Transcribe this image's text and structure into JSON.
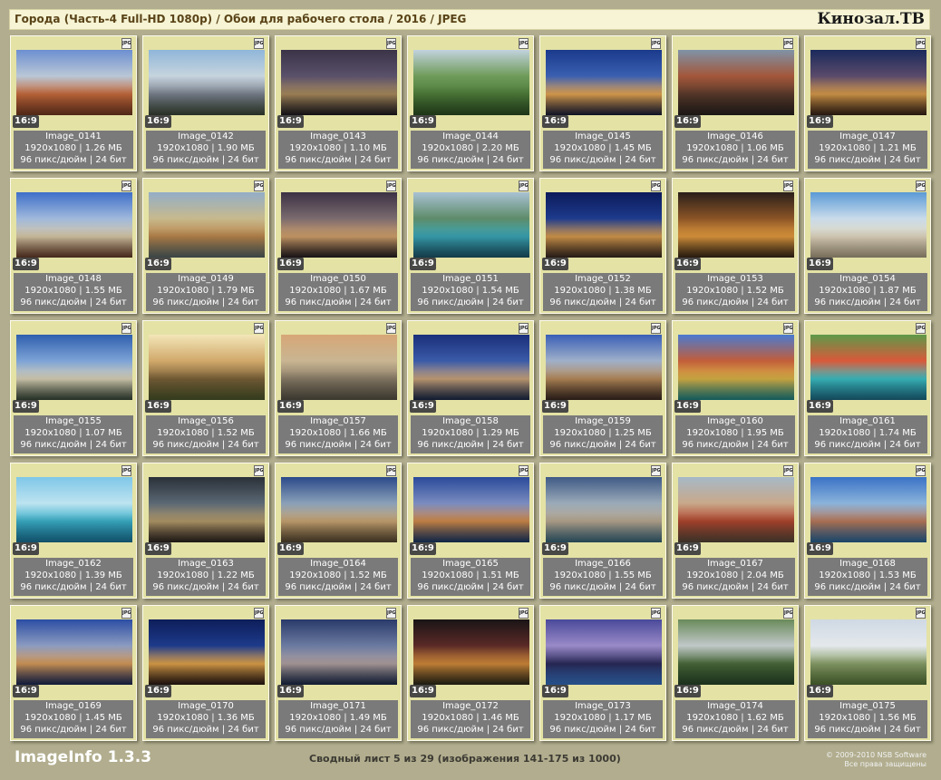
{
  "header": {
    "title": "Города (Часть-4 Full-HD 1080p) / Обои для рабочего стола / 2016 / JPEG",
    "brand": "Кинозал.TB"
  },
  "card_common": {
    "format_icon": "jpg-file-icon",
    "format_label": "JPG",
    "ratio": "16:9",
    "resolution_info": "96 пикс/дюйм | 24 бит"
  },
  "images": [
    {
      "name": "Image_0141",
      "dims": "1920x1080 | 1.26 МБ",
      "colors": [
        "#6d8fd1",
        "#b9c7d6",
        "#c76b3c",
        "#7a3b22"
      ]
    },
    {
      "name": "Image_0142",
      "dims": "1920x1080 | 1.90 МБ",
      "colors": [
        "#8fb6d9",
        "#c6d4de",
        "#7b8390",
        "#3e4a3a"
      ]
    },
    {
      "name": "Image_0143",
      "dims": "1920x1080 | 1.10 МБ",
      "colors": [
        "#3b3447",
        "#59506a",
        "#a88a5c",
        "#1f1b22"
      ]
    },
    {
      "name": "Image_0144",
      "dims": "1920x1080 | 2.20 МБ",
      "colors": [
        "#c2d3de",
        "#6f9b5a",
        "#4e7d3a",
        "#2e5224"
      ]
    },
    {
      "name": "Image_0145",
      "dims": "1920x1080 | 1.45 МБ",
      "colors": [
        "#1b3a8c",
        "#3a5fb0",
        "#e4a451",
        "#1a1f3a"
      ]
    },
    {
      "name": "Image_0146",
      "dims": "1920x1080 | 1.06 МБ",
      "colors": [
        "#7f93a8",
        "#a3573a",
        "#5b3b2c",
        "#2a2320"
      ]
    },
    {
      "name": "Image_0147",
      "dims": "1920x1080 | 1.21 МБ",
      "colors": [
        "#1a2a5c",
        "#5a4a6a",
        "#d79a4a",
        "#3a2418"
      ]
    },
    {
      "name": "Image_0148",
      "dims": "1920x1080 | 1.55 МБ",
      "colors": [
        "#3f6fc9",
        "#9fb8dc",
        "#d8c8a6",
        "#6a3e2a"
      ]
    },
    {
      "name": "Image_0149",
      "dims": "1920x1080 | 1.79 МБ",
      "colors": [
        "#93aec8",
        "#c7b98d",
        "#b9854b",
        "#5a6a6a"
      ]
    },
    {
      "name": "Image_0150",
      "dims": "1920x1080 | 1.67 МБ",
      "colors": [
        "#3c3244",
        "#7a6a6e",
        "#d1a06a",
        "#251d22"
      ]
    },
    {
      "name": "Image_0151",
      "dims": "1920x1080 | 1.54 МБ",
      "colors": [
        "#a9c2d4",
        "#5e8c6a",
        "#3aa6b7",
        "#1f5a6e"
      ]
    },
    {
      "name": "Image_0152",
      "dims": "1920x1080 | 1.38 МБ",
      "colors": [
        "#0c1a5a",
        "#1d3a8c",
        "#d69a4c",
        "#3a2a22"
      ]
    },
    {
      "name": "Image_0153",
      "dims": "1920x1080 | 1.52 МБ",
      "colors": [
        "#2a1f1a",
        "#8a5426",
        "#e29a3e",
        "#3a2818"
      ]
    },
    {
      "name": "Image_0154",
      "dims": "1920x1080 | 1.87 МБ",
      "colors": [
        "#5a9ad6",
        "#c9dbea",
        "#e2d8c0",
        "#b7a88a"
      ]
    },
    {
      "name": "Image_0155",
      "dims": "1920x1080 | 1.07 МБ",
      "colors": [
        "#2f5fae",
        "#7da3d6",
        "#d9d1b6",
        "#3a4a3a"
      ]
    },
    {
      "name": "Image_0156",
      "dims": "1920x1080 | 1.52 МБ",
      "colors": [
        "#f3e6b8",
        "#d1a96b",
        "#7a6038",
        "#4e5a2c"
      ]
    },
    {
      "name": "Image_0157",
      "dims": "1920x1080 | 1.66 МБ",
      "colors": [
        "#d7a777",
        "#c9b592",
        "#8a7d68",
        "#5a5548"
      ]
    },
    {
      "name": "Image_0158",
      "dims": "1920x1080 | 1.29 МБ",
      "colors": [
        "#1b2f7a",
        "#3a5aa8",
        "#c8a27a",
        "#1a2a4a"
      ]
    },
    {
      "name": "Image_0159",
      "dims": "1920x1080 | 1.25 МБ",
      "colors": [
        "#3a5fb6",
        "#9fb0c9",
        "#b78a5a",
        "#3c2a22"
      ]
    },
    {
      "name": "Image_0160",
      "dims": "1920x1080 | 1.95 МБ",
      "colors": [
        "#4a7bd1",
        "#c25e3a",
        "#d9b347",
        "#1f8a8a"
      ]
    },
    {
      "name": "Image_0161",
      "dims": "1920x1080 | 1.74 МБ",
      "colors": [
        "#5d9a4a",
        "#d9593a",
        "#3bbfc4",
        "#1e6f8a"
      ]
    },
    {
      "name": "Image_0162",
      "dims": "1920x1080 | 1.39 МБ",
      "colors": [
        "#7fc7e8",
        "#bde3f0",
        "#3ab0c9",
        "#1a7aa0"
      ]
    },
    {
      "name": "Image_0163",
      "dims": "1920x1080 | 1.22 МБ",
      "colors": [
        "#2a3038",
        "#5a6874",
        "#b49a6a",
        "#2c2420"
      ]
    },
    {
      "name": "Image_0164",
      "dims": "1920x1080 | 1.52 МБ",
      "colors": [
        "#2b4a8a",
        "#8aa0b8",
        "#c9a572",
        "#5a4a32"
      ]
    },
    {
      "name": "Image_0165",
      "dims": "1920x1080 | 1.51 МБ",
      "colors": [
        "#2a4a9a",
        "#7a8cc0",
        "#d18a4a",
        "#1a3a6a"
      ]
    },
    {
      "name": "Image_0166",
      "dims": "1920x1080 | 1.55 МБ",
      "colors": [
        "#3f5a86",
        "#9aaab8",
        "#b8a890",
        "#3a6a80"
      ]
    },
    {
      "name": "Image_0167",
      "dims": "1920x1080 | 2.04 МБ",
      "colors": [
        "#a6b9c8",
        "#c9a88a",
        "#b0462e",
        "#5a4a3a"
      ]
    },
    {
      "name": "Image_0168",
      "dims": "1920x1080 | 1.53 МБ",
      "colors": [
        "#3a72c6",
        "#8ab3db",
        "#b97a5a",
        "#2a6aa0"
      ]
    },
    {
      "name": "Image_0169",
      "dims": "1920x1080 | 1.45 МБ",
      "colors": [
        "#2c4ea4",
        "#8b9bc0",
        "#d69a5a",
        "#1a2a5a"
      ]
    },
    {
      "name": "Image_0170",
      "dims": "1920x1080 | 1.36 МБ",
      "colors": [
        "#0e1e5a",
        "#1d3a8a",
        "#e0a24a",
        "#2a1a14"
      ]
    },
    {
      "name": "Image_0171",
      "dims": "1920x1080 | 1.49 МБ",
      "colors": [
        "#2a3a6a",
        "#6a7aa0",
        "#b0a0a0",
        "#1a2a4a"
      ]
    },
    {
      "name": "Image_0172",
      "dims": "1920x1080 | 1.46 МБ",
      "colors": [
        "#1a1416",
        "#5a2a26",
        "#d18a3a",
        "#2c2a1a"
      ]
    },
    {
      "name": "Image_0173",
      "dims": "1920x1080 | 1.17 МБ",
      "colors": [
        "#4a4a9a",
        "#9a8ac8",
        "#2a2a5a",
        "#3a7ad1"
      ]
    },
    {
      "name": "Image_0174",
      "dims": "1920x1080 | 1.62 МБ",
      "colors": [
        "#6a8a5a",
        "#c0c8c8",
        "#4a6a3a",
        "#2a4a2a"
      ]
    },
    {
      "name": "Image_0175",
      "dims": "1920x1080 | 1.56 МБ",
      "colors": [
        "#cfd9e4",
        "#e4e8ec",
        "#8aa06a",
        "#5a7a3a"
      ]
    }
  ],
  "footer": {
    "app_name": "ImageInfo 1.3.3",
    "summary": "Сводный лист 5 из 29 (изображения 141-175 из 1000)",
    "copyright_line1": "© 2009-2010 NSB Software",
    "copyright_line2": "Все права защищены"
  }
}
